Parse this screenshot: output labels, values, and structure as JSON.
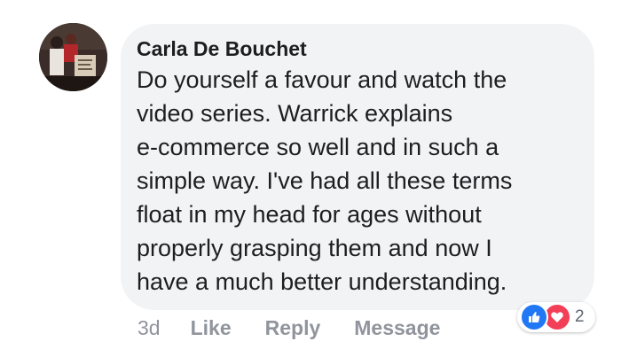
{
  "comment": {
    "author": "Carla De Bouchet",
    "text": "Do yourself a favour and watch the\nvideo series. Warrick explains\ne-commerce so well and in such a\nsimple way. I've had all these terms\nfloat in my head for ages without\nproperly grasping them and now I\nhave a much better understanding.",
    "timestamp": "3d",
    "actions": {
      "like": "Like",
      "reply": "Reply",
      "message": "Message"
    },
    "reactions": {
      "types": [
        "like-icon",
        "love-icon"
      ],
      "count": "2"
    }
  },
  "colors": {
    "bubble": "#f2f3f5",
    "text": "#1c1e21",
    "meta": "#90949c",
    "like": "#2078f4",
    "love": "#f33e58"
  }
}
